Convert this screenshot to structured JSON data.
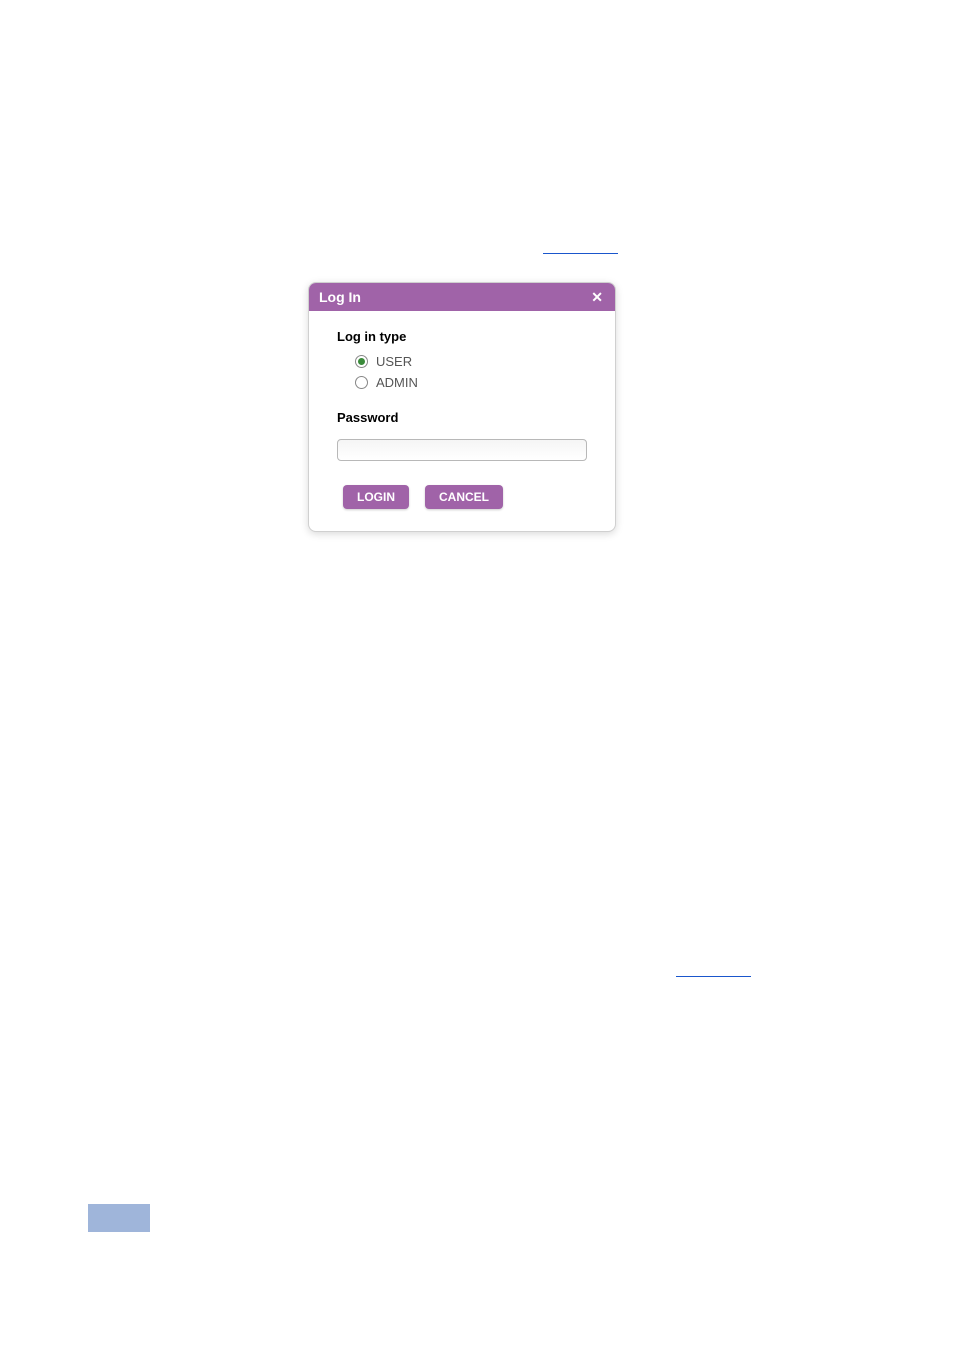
{
  "dialog": {
    "title": "Log In",
    "login_type_label": "Log in type",
    "radio_options": [
      {
        "label": "USER",
        "selected": true
      },
      {
        "label": "ADMIN",
        "selected": false
      }
    ],
    "password_label": "Password",
    "password_value": "",
    "login_button": "LOGIN",
    "cancel_button": "CANCEL"
  },
  "colors": {
    "brand_purple": "#a063a8",
    "radio_selected_green": "#3a8a3a",
    "link_blue": "#1a56cc",
    "pagenum_bg": "#9fb5da"
  }
}
